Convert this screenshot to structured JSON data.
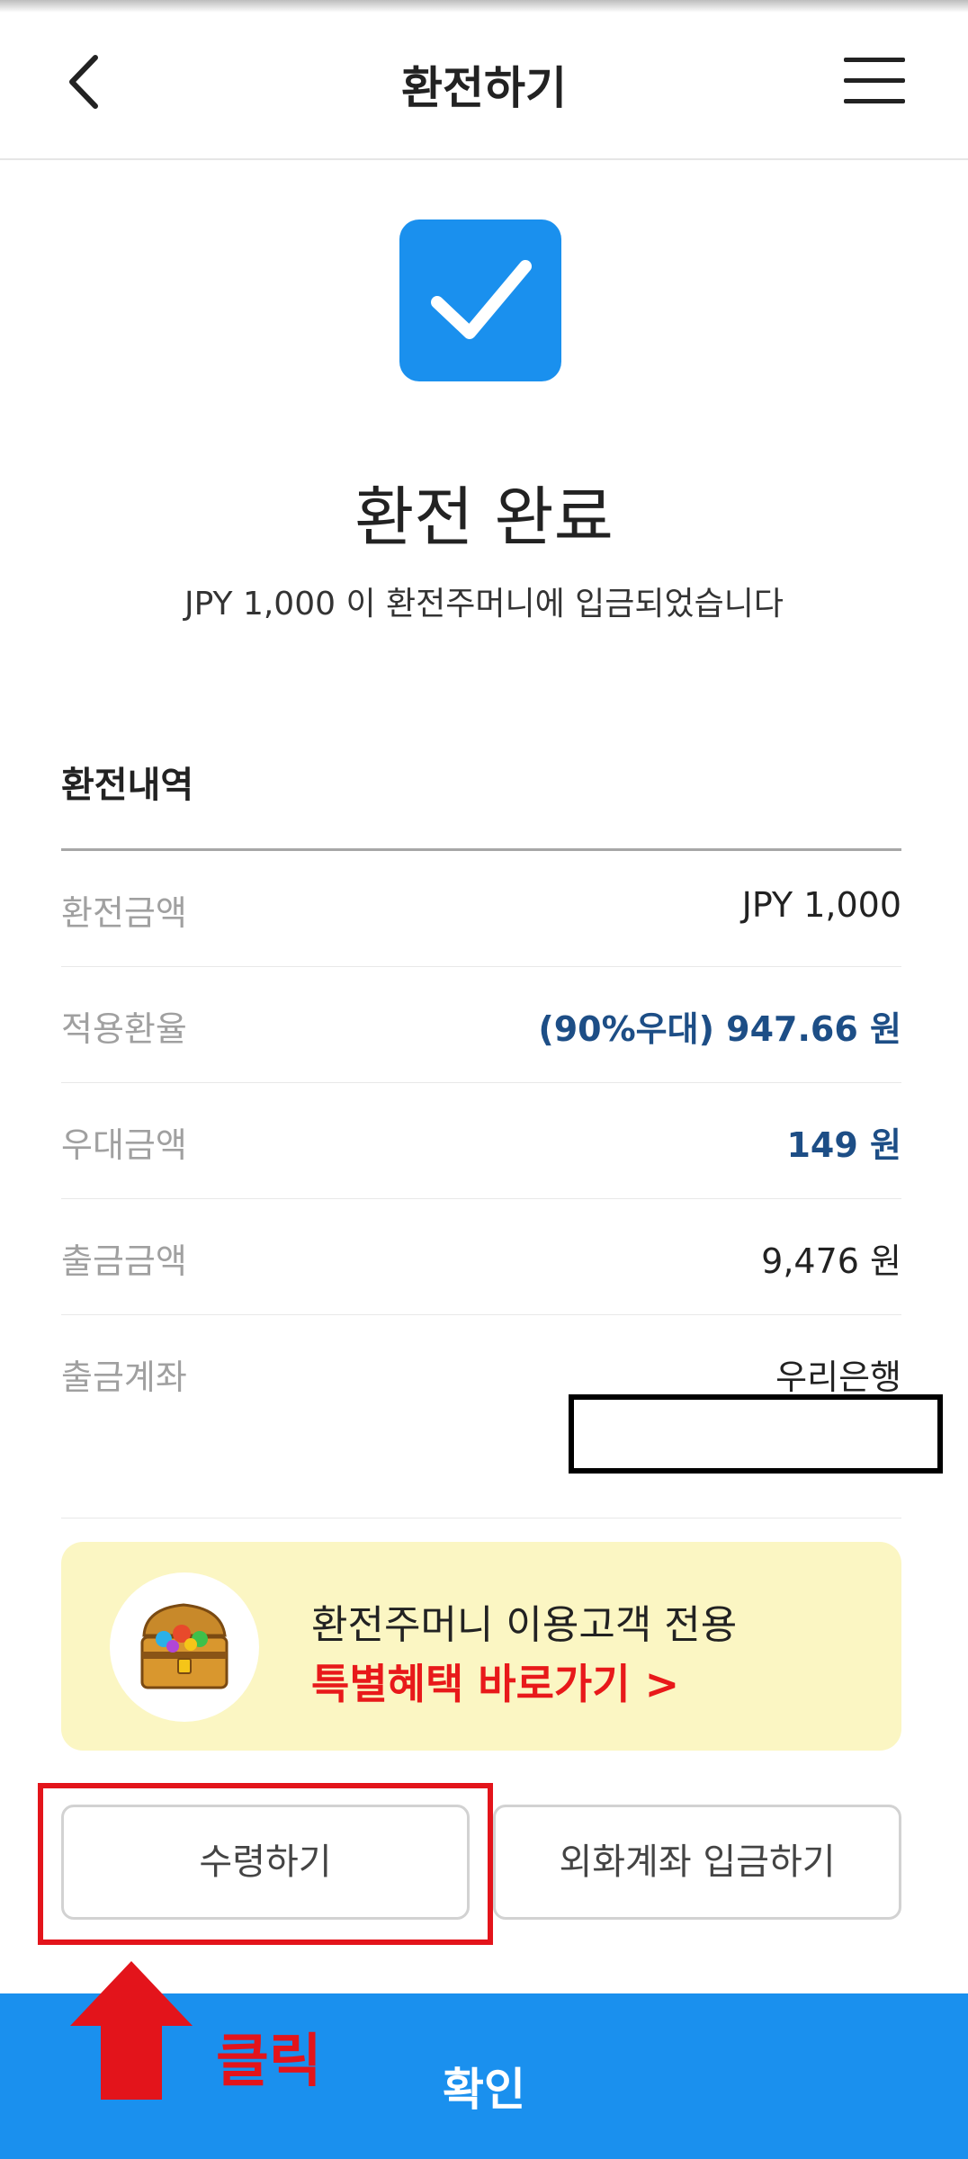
{
  "header": {
    "title": "환전하기",
    "back_icon": "chevron-left-icon",
    "menu_icon": "hamburger-menu-icon"
  },
  "hero": {
    "icon": "checkmark-icon",
    "title": "환전 완료",
    "message": "JPY 1,000 이 환전주머니에 입금되었습니다"
  },
  "history": {
    "title": "환전내역",
    "rows": [
      {
        "label": "환전금액",
        "value": "JPY 1,000"
      },
      {
        "label": "적용환율",
        "value": "(90%우대) 947.66 원"
      },
      {
        "label": "우대금액",
        "value": "149 원"
      },
      {
        "label": "출금금액",
        "value": "9,476 원"
      },
      {
        "label": "출금계좌",
        "value": "우리은행"
      }
    ]
  },
  "banner": {
    "icon": "treasure-chest-icon",
    "line1": "환전주머니 이용고객 전용",
    "line2": "특별혜택 바로가기 >"
  },
  "buttons": {
    "receive": "수령하기",
    "deposit": "외화계좌 입금하기",
    "confirm": "확인"
  },
  "annotation": {
    "click_label": "클릭",
    "arrow_icon": "red-up-arrow-icon"
  },
  "colors": {
    "primary_blue": "#1a90ee",
    "value_blue": "#1d4e86",
    "accent_red": "#e8191a",
    "banner_bg": "#fbf6c3"
  }
}
